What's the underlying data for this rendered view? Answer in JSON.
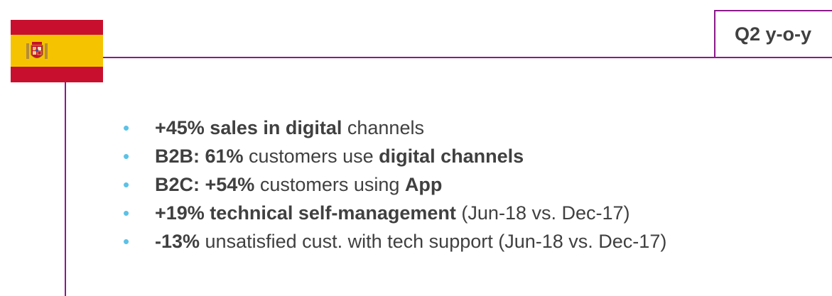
{
  "flag": {
    "colors": {
      "red": "#c8102e",
      "yellow": "#f6c300"
    },
    "icon": "spain-flag-icon"
  },
  "period": {
    "label": "Q2 y-o-y"
  },
  "accent_color": "#8a1a8a",
  "bullet_color": "#5bc2e7",
  "bullets": [
    {
      "parts": [
        {
          "text": "+45% sales in digital",
          "bold": true
        },
        {
          "text": " channels",
          "bold": false
        }
      ]
    },
    {
      "parts": [
        {
          "text": "B2B: 61%",
          "bold": true
        },
        {
          "text": " customers use ",
          "bold": false
        },
        {
          "text": "digital channels",
          "bold": true
        }
      ]
    },
    {
      "parts": [
        {
          "text": "B2C: +54%",
          "bold": true
        },
        {
          "text": " customers using ",
          "bold": false
        },
        {
          "text": "App",
          "bold": true
        }
      ]
    },
    {
      "parts": [
        {
          "text": "+19% technical self-management",
          "bold": true
        },
        {
          "text": " (Jun-18 vs. Dec-17)",
          "bold": false
        }
      ]
    },
    {
      "parts": [
        {
          "text": "-13%",
          "bold": true
        },
        {
          "text": " unsatisfied cust. with tech support (Jun-18 vs. Dec-17)",
          "bold": false
        }
      ]
    }
  ]
}
